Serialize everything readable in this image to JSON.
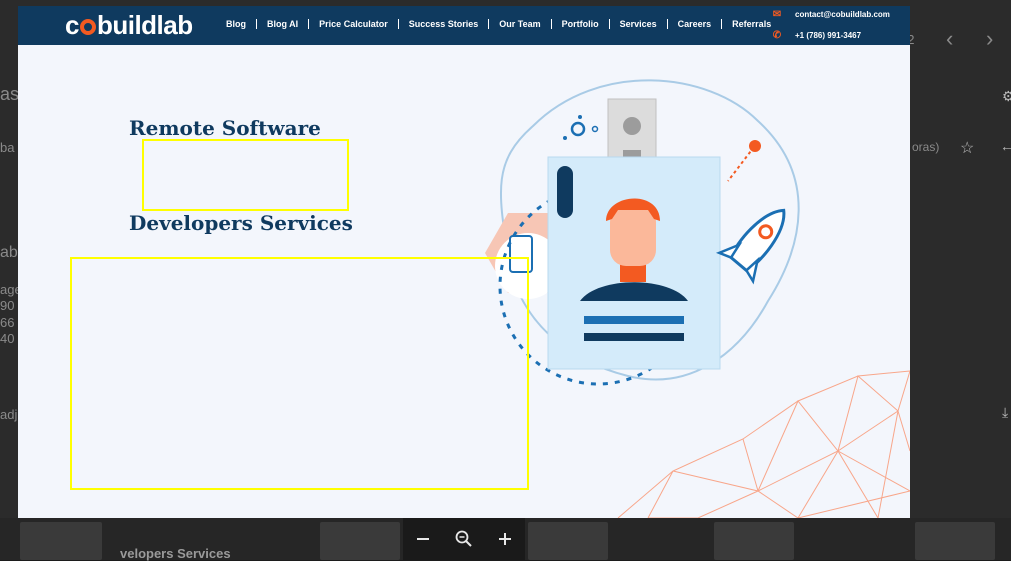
{
  "background": {
    "page_counter": "02",
    "right_snippet": "oras)",
    "left_snippets": [
      "as",
      "ba",
      "ab",
      "age",
      "90",
      "66",
      "40",
      "adj"
    ],
    "bottom_caption": "velopers Services"
  },
  "header": {
    "logo": {
      "pre": "c",
      "post": "buildlab"
    },
    "nav": [
      "Blog",
      "Blog AI",
      "Price Calculator",
      "Success Stories",
      "Our Team",
      "Portfolio",
      "Services",
      "Careers",
      "Referrals"
    ],
    "email": "contact@cobuildlab.com",
    "phone": "+1 (786) 991-3467"
  },
  "hero": {
    "title_line1": "Remote Software",
    "title_line2": "Developers Services"
  },
  "colors": {
    "navy": "#0f3a5f",
    "orange": "#f35a21",
    "highlight": "#ffff00",
    "card": "#d4ebfa"
  },
  "icons": {
    "email": "mail-icon",
    "phone": "phone-icon",
    "prev": "chevron-left-icon",
    "next": "chevron-right-icon",
    "zoom_out": "minus-icon",
    "zoom_search": "zoom-icon",
    "zoom_in": "plus-icon",
    "star": "star-icon"
  }
}
